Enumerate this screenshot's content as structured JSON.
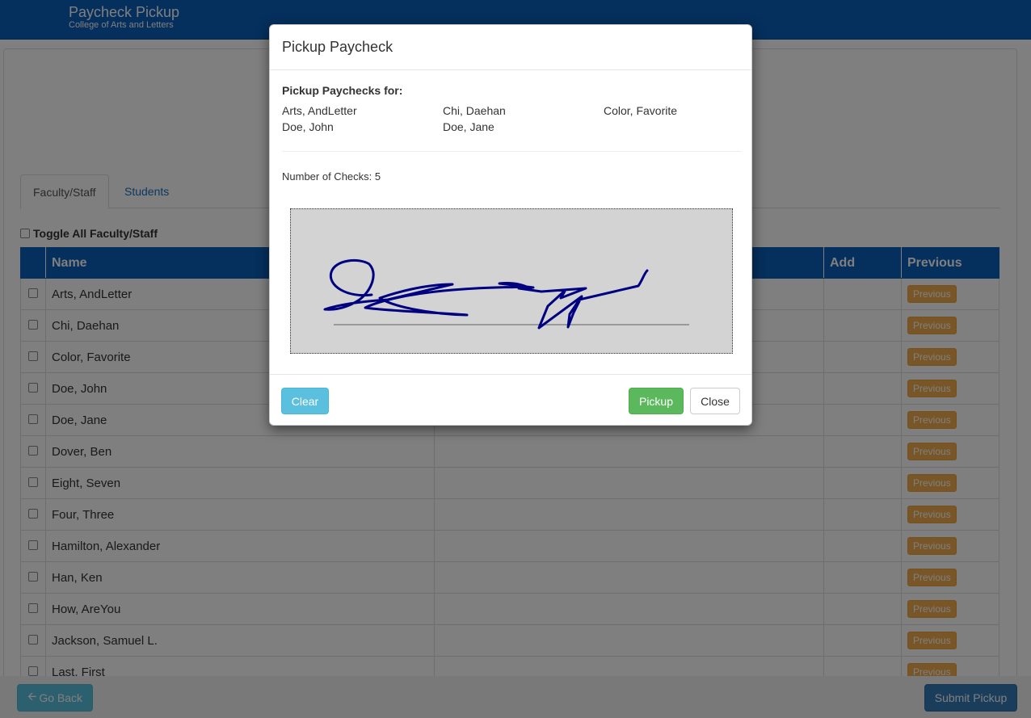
{
  "header": {
    "title": "Paycheck Pickup",
    "subtitle": "College of Arts and Letters"
  },
  "tabs": [
    {
      "label": "Faculty/Staff"
    },
    {
      "label": "Students"
    }
  ],
  "toggle_all_label": "Toggle All Faculty/Staff",
  "table": {
    "headers": {
      "name": "Name",
      "add": "Add",
      "previous": "Previous"
    },
    "rows": [
      {
        "name": "Arts, AndLetter",
        "previous": "Previous"
      },
      {
        "name": "Chi, Daehan",
        "previous": "Previous"
      },
      {
        "name": "Color, Favorite",
        "previous": "Previous"
      },
      {
        "name": "Doe, John",
        "previous": "Previous"
      },
      {
        "name": "Doe, Jane",
        "previous": "Previous"
      },
      {
        "name": "Dover, Ben",
        "previous": "Previous"
      },
      {
        "name": "Eight, Seven",
        "previous": "Previous"
      },
      {
        "name": "Four, Three",
        "previous": "Previous"
      },
      {
        "name": "Hamilton, Alexander",
        "previous": "Previous"
      },
      {
        "name": "Han, Ken",
        "previous": "Previous"
      },
      {
        "name": "How, AreYou",
        "previous": "Previous"
      },
      {
        "name": "Jackson, Samuel L.",
        "previous": "Previous"
      },
      {
        "name": "Last, First",
        "previous": "Previous"
      }
    ]
  },
  "footer": {
    "go_back": "Go Back",
    "go_back_icon": "arrow-left-icon",
    "submit": "Submit Pickup"
  },
  "modal": {
    "title": "Pickup Paycheck",
    "for_label": "Pickup Paychecks for:",
    "names": [
      "Arts, AndLetter",
      "Chi, Daehan",
      "Color, Favorite",
      "Doe, John",
      "Doe, Jane"
    ],
    "num_checks": "Number of Checks: 5",
    "buttons": {
      "clear": "Clear",
      "pickup": "Pickup",
      "close": "Close"
    }
  },
  "colors": {
    "brand": "#0a5fb8",
    "warning": "#f0ad4e",
    "success": "#5cb85c",
    "info": "#5bc0de",
    "primary": "#337ab7",
    "ink": "#000080"
  }
}
